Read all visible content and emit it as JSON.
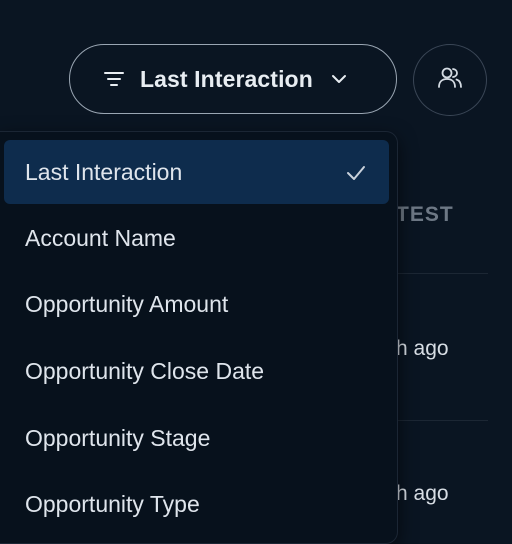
{
  "sort_control": {
    "label": "Last Interaction",
    "filter_icon": "filter-lines-icon",
    "chevron_icon": "chevron-down-icon"
  },
  "people_button": {
    "icon": "users-icon"
  },
  "background_table": {
    "column_header": "TEST",
    "cells": [
      "h ago",
      "h ago"
    ]
  },
  "dropdown": {
    "selected": "Last Interaction",
    "items": [
      {
        "label": "Last Interaction"
      },
      {
        "label": "Account Name"
      },
      {
        "label": "Opportunity Amount"
      },
      {
        "label": "Opportunity Close Date"
      },
      {
        "label": "Opportunity Stage"
      },
      {
        "label": "Opportunity Type"
      }
    ],
    "check_icon": "check-icon"
  },
  "colors": {
    "background": "#0a1522",
    "dropdown_bg": "#07111c",
    "selected_bg": "#0e2c4d",
    "text": "#dfe5ec",
    "border": "#9aa6b3"
  }
}
